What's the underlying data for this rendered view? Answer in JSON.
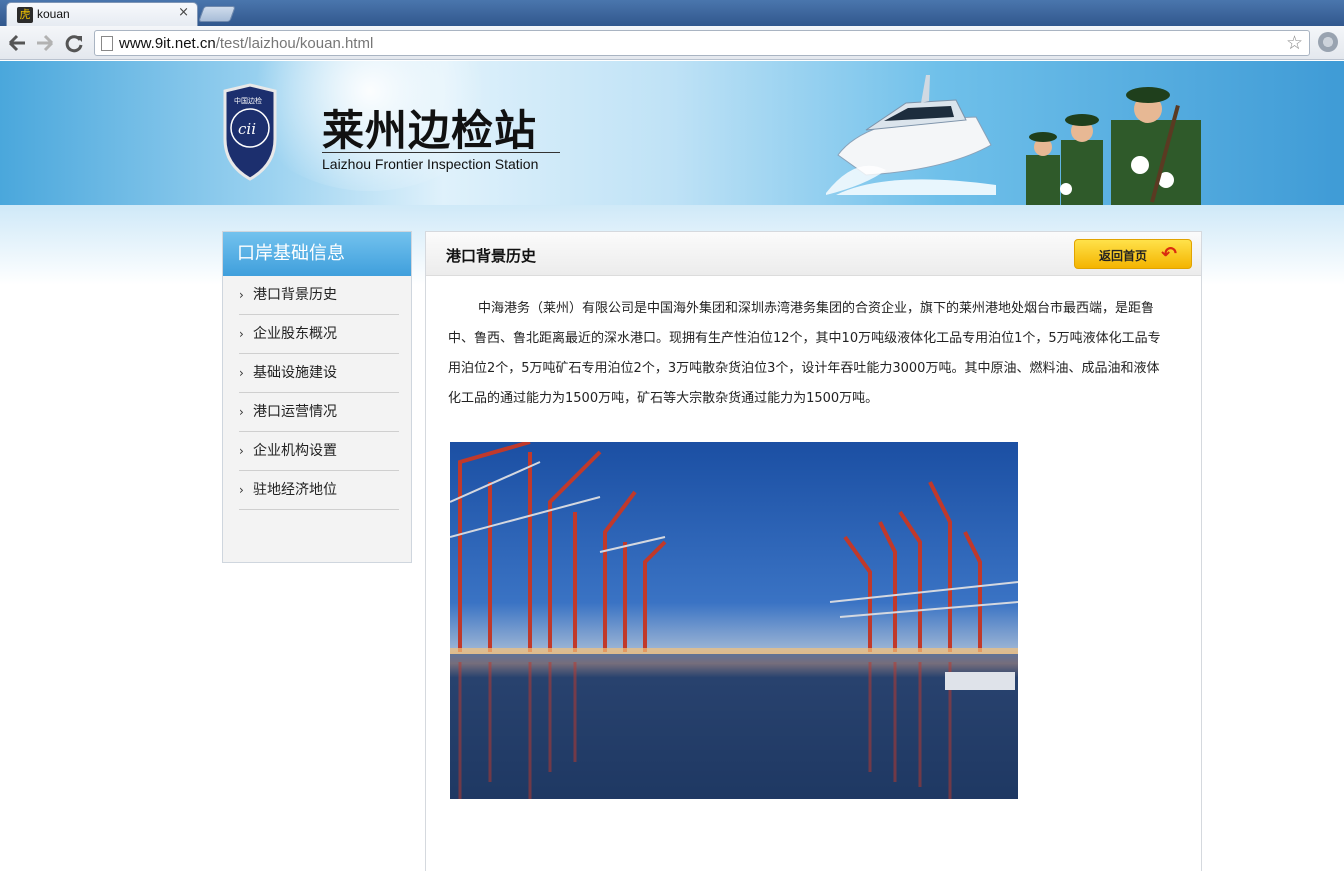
{
  "browser": {
    "tab_title": "kouan",
    "favicon_glyph": "虎",
    "close_glyph": "×",
    "url_host": "www.9it.net.cn",
    "url_path": "/test/laizhou/kouan.html"
  },
  "header": {
    "title_cn": "莱州边检站",
    "title_en": "Laizhou Frontier Inspection Station",
    "emblem_text_top": "中国边检",
    "emblem_text_ring": "CHINA IMMIGRATION INSPECTION"
  },
  "sidebar": {
    "heading": "口岸基础信息",
    "items": [
      {
        "label": "港口背景历史"
      },
      {
        "label": "企业股东概况"
      },
      {
        "label": "基础设施建设"
      },
      {
        "label": "港口运营情况"
      },
      {
        "label": "企业机构设置"
      },
      {
        "label": "驻地经济地位"
      }
    ]
  },
  "content": {
    "title": "港口背景历史",
    "home_button_label": "返回首页",
    "article": "中海港务（莱州）有限公司是中国海外集团和深圳赤湾港务集团的合资企业，旗下的莱州港地处烟台市最西端，是距鲁中、鲁西、鲁北距离最近的深水港口。现拥有生产性泊位12个，其中10万吨级液体化工品专用泊位1个，5万吨液体化工品专用泊位2个，5万吨矿石专用泊位2个，3万吨散杂货泊位3个，设计年吞吐能力3000万吨。其中原油、燃料油、成品油和液体化工品的通过能力为1500万吨，矿石等大宗散杂货通过能力为1500万吨。"
  },
  "colors": {
    "sidebar_head": "#3f9fdc",
    "home_button": "#f4b400",
    "banner": "#4aa7dc"
  }
}
